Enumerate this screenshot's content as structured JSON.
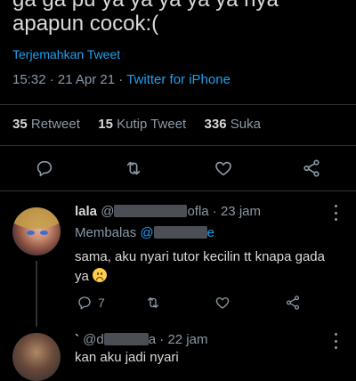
{
  "tweet": {
    "text_cut_top": "ga ga pu ya  ya  ya  ya  ya  nya",
    "text_line": "apapun cocok:(",
    "translate_label": "Terjemahkan Tweet",
    "time": "15:32",
    "date": "21 Apr 21",
    "source": "Twitter for iPhone",
    "retweets_count": "35",
    "retweets_label": "Retweet",
    "quotes_count": "15",
    "quotes_label": "Kutip Tweet",
    "likes_count": "336",
    "likes_label": "Suka"
  },
  "reply1": {
    "name": "lala",
    "handle_prefix": "@",
    "handle_suffix": "ofla",
    "time": "23 jam",
    "replying_label": "Membalas",
    "replying_prefix": "@",
    "replying_suffix": "e",
    "body": "sama, aku nyari tutor kecilin tt knapa gada ya",
    "reply_count": "7"
  },
  "reply2": {
    "name": "`",
    "handle_prefix": "@d",
    "handle_suffix": "a",
    "time": "22 jam",
    "body_cut": "kan  aku   jadi  nyari"
  },
  "icons": {
    "reply": "reply-icon",
    "retweet": "retweet-icon",
    "like": "heart-icon",
    "share": "share-icon",
    "more": "more-vertical-icon"
  }
}
